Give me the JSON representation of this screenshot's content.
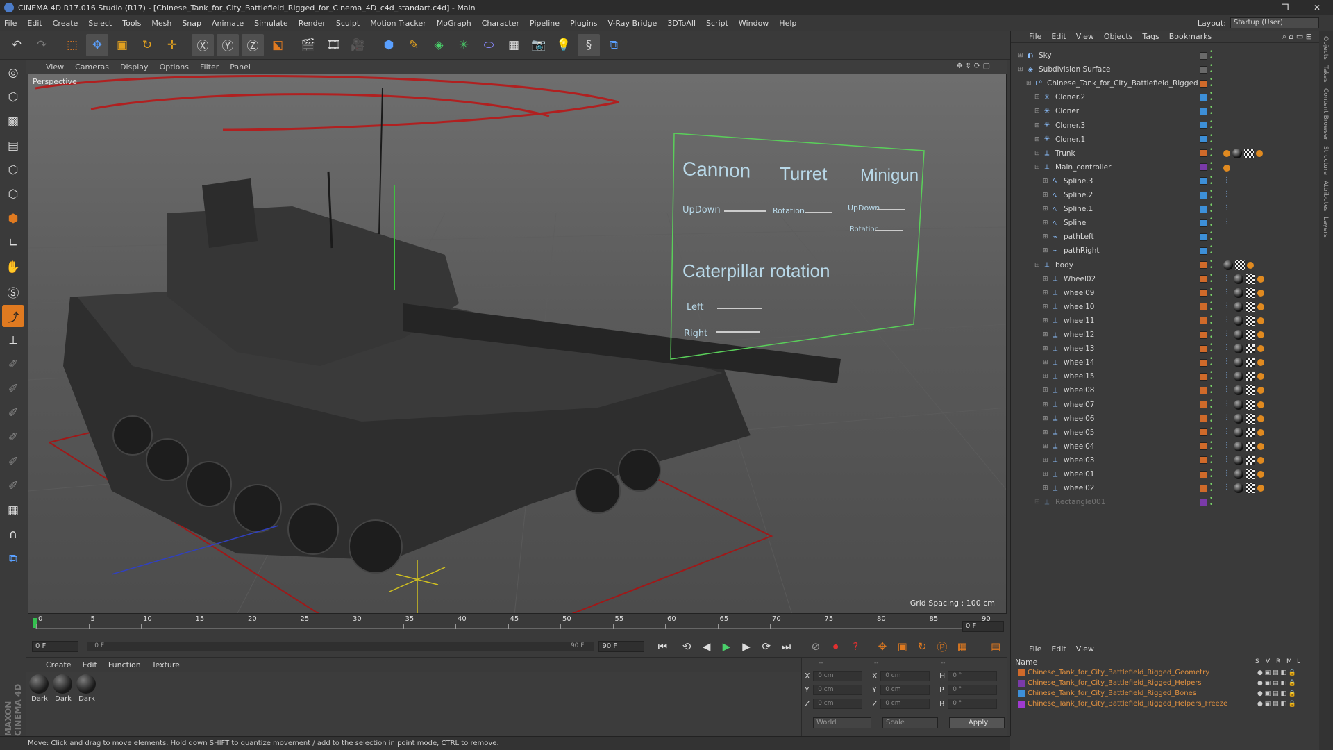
{
  "window": {
    "title": "CINEMA 4D R17.016 Studio (R17) - [Chinese_Tank_for_City_Battlefield_Rigged_for_Cinema_4D_c4d_standart.c4d] - Main",
    "minimize": "—",
    "maximize": "❐",
    "close": "✕"
  },
  "menubar": [
    "File",
    "Edit",
    "Create",
    "Select",
    "Tools",
    "Mesh",
    "Snap",
    "Animate",
    "Simulate",
    "Render",
    "Sculpt",
    "Motion Tracker",
    "MoGraph",
    "Character",
    "Pipeline",
    "Plugins",
    "V-Ray Bridge",
    "3DToAll",
    "Script",
    "Window",
    "Help"
  ],
  "layout": {
    "label": "Layout:",
    "value": "Startup (User)"
  },
  "viewport": {
    "menu": [
      "View",
      "Cameras",
      "Display",
      "Options",
      "Filter",
      "Panel"
    ],
    "label": "Perspective",
    "grid_spacing": "Grid Spacing : 100 cm",
    "hud": {
      "cannon": "Cannon",
      "turret": "Turret",
      "minigun": "Minigun",
      "updown": "UpDown",
      "rotation": "Rotation",
      "updown2": "UpDown",
      "rotation2": "Rotation",
      "caterpillar": "Caterpillar rotation",
      "left": "Left",
      "right": "Right"
    }
  },
  "timeline": {
    "ticks": [
      "0",
      "5",
      "10",
      "15",
      "20",
      "25",
      "30",
      "35",
      "40",
      "45",
      "50",
      "55",
      "60",
      "65",
      "70",
      "75",
      "80",
      "85",
      "90"
    ],
    "current_frame": "0 F",
    "start": "0 F",
    "range_start": "0 F",
    "range_end": "90 F",
    "end": "90 F"
  },
  "material_panel": {
    "menu": [
      "Create",
      "Edit",
      "Function",
      "Texture"
    ],
    "materials": [
      "Dark",
      "Dark",
      "Dark"
    ]
  },
  "coords": {
    "rows": [
      {
        "a": "X",
        "v1": "0 cm",
        "b": "X",
        "v2": "0 cm",
        "c": "H",
        "v3": "0 °"
      },
      {
        "a": "Y",
        "v1": "0 cm",
        "b": "Y",
        "v2": "0 cm",
        "c": "P",
        "v3": "0 °"
      },
      {
        "a": "Z",
        "v1": "0 cm",
        "b": "Z",
        "v2": "0 cm",
        "c": "B",
        "v3": "0 °"
      }
    ],
    "world": "World",
    "scale": "Scale",
    "apply": "Apply",
    "dash1": "--",
    "dash2": "--",
    "dash3": "--"
  },
  "status": "Move: Click and drag to move elements. Hold down SHIFT to quantize movement / add to the selection in point mode, CTRL to remove.",
  "brand": "MAXON CINEMA 4D",
  "object_manager": {
    "menu": [
      "File",
      "Edit",
      "View",
      "Objects",
      "Tags",
      "Bookmarks"
    ],
    "objects": [
      {
        "name": "Sky",
        "indent": 0,
        "color": "#6a6a6a",
        "tags": []
      },
      {
        "name": "Subdivision Surface",
        "indent": 0,
        "color": "#6a6a6a",
        "tags": []
      },
      {
        "name": "Chinese_Tank_for_City_Battlefield_Rigged",
        "indent": 1,
        "color": "#d06a2a",
        "tags": []
      },
      {
        "name": "Cloner.2",
        "indent": 2,
        "color": "#3d8fd8",
        "tags": []
      },
      {
        "name": "Cloner",
        "indent": 2,
        "color": "#3d8fd8",
        "tags": []
      },
      {
        "name": "Cloner.3",
        "indent": 2,
        "color": "#3d8fd8",
        "tags": []
      },
      {
        "name": "Cloner.1",
        "indent": 2,
        "color": "#3d8fd8",
        "tags": []
      },
      {
        "name": "Trunk",
        "indent": 2,
        "color": "#d06a2a",
        "tags": [
          "org",
          "blk",
          "chk",
          "org"
        ]
      },
      {
        "name": "Main_controller",
        "indent": 2,
        "color": "#7a3aa8",
        "tags": [
          "org"
        ]
      },
      {
        "name": "Spline.3",
        "indent": 3,
        "color": "#3d8fd8",
        "tags": [
          "spl"
        ]
      },
      {
        "name": "Spline.2",
        "indent": 3,
        "color": "#3d8fd8",
        "tags": [
          "spl"
        ]
      },
      {
        "name": "Spline.1",
        "indent": 3,
        "color": "#3d8fd8",
        "tags": [
          "spl"
        ]
      },
      {
        "name": "Spline",
        "indent": 3,
        "color": "#3d8fd8",
        "tags": [
          "spl"
        ]
      },
      {
        "name": "pathLeft",
        "indent": 3,
        "color": "#3d8fd8",
        "tags": []
      },
      {
        "name": "pathRight",
        "indent": 3,
        "color": "#3d8fd8",
        "tags": []
      },
      {
        "name": "body",
        "indent": 2,
        "color": "#d06a2a",
        "tags": [
          "blk",
          "chk",
          "org"
        ]
      },
      {
        "name": "Wheel02",
        "indent": 3,
        "color": "#d06a2a",
        "tags": [
          "spl",
          "blk",
          "chk",
          "org"
        ]
      },
      {
        "name": "wheel09",
        "indent": 3,
        "color": "#d06a2a",
        "tags": [
          "spl",
          "blk",
          "chk",
          "org"
        ]
      },
      {
        "name": "wheel10",
        "indent": 3,
        "color": "#d06a2a",
        "tags": [
          "spl",
          "blk",
          "chk",
          "org"
        ]
      },
      {
        "name": "wheel11",
        "indent": 3,
        "color": "#d06a2a",
        "tags": [
          "spl",
          "blk",
          "chk",
          "org"
        ]
      },
      {
        "name": "wheel12",
        "indent": 3,
        "color": "#d06a2a",
        "tags": [
          "spl",
          "blk",
          "chk",
          "org"
        ]
      },
      {
        "name": "wheel13",
        "indent": 3,
        "color": "#d06a2a",
        "tags": [
          "spl",
          "blk",
          "chk",
          "org"
        ]
      },
      {
        "name": "wheel14",
        "indent": 3,
        "color": "#d06a2a",
        "tags": [
          "spl",
          "blk",
          "chk",
          "org"
        ]
      },
      {
        "name": "wheel15",
        "indent": 3,
        "color": "#d06a2a",
        "tags": [
          "spl",
          "blk",
          "chk",
          "org"
        ]
      },
      {
        "name": "wheel08",
        "indent": 3,
        "color": "#d06a2a",
        "tags": [
          "spl",
          "blk",
          "chk",
          "org"
        ]
      },
      {
        "name": "wheel07",
        "indent": 3,
        "color": "#d06a2a",
        "tags": [
          "spl",
          "blk",
          "chk",
          "org"
        ]
      },
      {
        "name": "wheel06",
        "indent": 3,
        "color": "#d06a2a",
        "tags": [
          "spl",
          "blk",
          "chk",
          "org"
        ]
      },
      {
        "name": "wheel05",
        "indent": 3,
        "color": "#d06a2a",
        "tags": [
          "spl",
          "blk",
          "chk",
          "org"
        ]
      },
      {
        "name": "wheel04",
        "indent": 3,
        "color": "#d06a2a",
        "tags": [
          "spl",
          "blk",
          "chk",
          "org"
        ]
      },
      {
        "name": "wheel03",
        "indent": 3,
        "color": "#d06a2a",
        "tags": [
          "spl",
          "blk",
          "chk",
          "org"
        ]
      },
      {
        "name": "wheel01",
        "indent": 3,
        "color": "#d06a2a",
        "tags": [
          "spl",
          "blk",
          "chk",
          "org"
        ]
      },
      {
        "name": "wheel02",
        "indent": 3,
        "color": "#d06a2a",
        "tags": [
          "spl",
          "blk",
          "chk",
          "org"
        ]
      },
      {
        "name": "Rectangle001",
        "indent": 2,
        "color": "#7a3aa8",
        "tags": [],
        "dim": true
      }
    ]
  },
  "layer_manager": {
    "menu": [
      "File",
      "Edit",
      "View"
    ],
    "header": {
      "name": "Name",
      "s": "S",
      "v": "V",
      "r": "R",
      "m": "M",
      "l": "L"
    },
    "layers": [
      {
        "name": "Chinese_Tank_for_City_Battlefield_Rigged_Geometry",
        "color": "#d06a2a"
      },
      {
        "name": "Chinese_Tank_for_City_Battlefield_Rigged_Helpers",
        "color": "#7a3aa8"
      },
      {
        "name": "Chinese_Tank_for_City_Battlefield_Rigged_Bones",
        "color": "#3d8fd8"
      },
      {
        "name": "Chinese_Tank_for_City_Battlefield_Rigged_Helpers_Freeze",
        "color": "#a03ad0"
      }
    ]
  },
  "side_tabs": [
    "Objects",
    "Takes",
    "Content Browser",
    "Structure",
    "Attributes",
    "Layers"
  ]
}
